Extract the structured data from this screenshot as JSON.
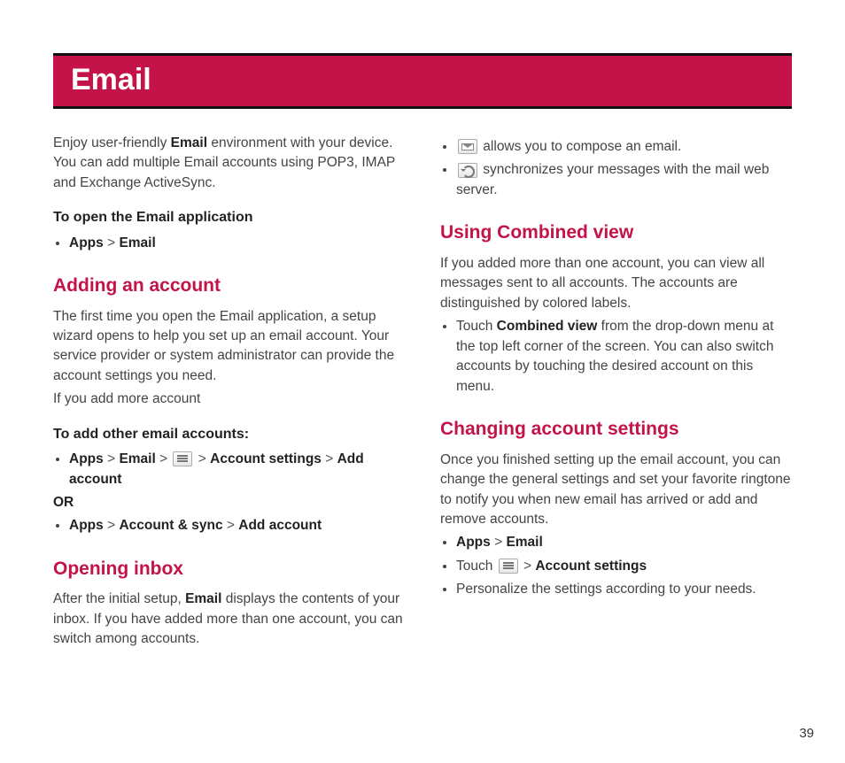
{
  "banner": {
    "title": "Email"
  },
  "left": {
    "intro": {
      "pre": "Enjoy user-friendly ",
      "bold": "Email",
      "post": " environment with your device. You can add multiple Email accounts using POP3, IMAP and Exchange ActiveSync."
    },
    "open_app": {
      "title": "To open the Email application",
      "path": {
        "a": "Apps",
        "sep": ">",
        "b": "Email"
      }
    },
    "adding": {
      "title": "Adding an account",
      "body1": "The first time you open the Email application, a setup wizard opens to help you set up an email account. Your service provider or system administrator can provide the account settings you need.",
      "body2": "If you add more account"
    },
    "add_other": {
      "title": "To add other email accounts:",
      "path1": {
        "a": "Apps",
        "b": "Email",
        "c": "Account settings",
        "d": "Add account"
      },
      "or": "OR",
      "path2": {
        "a": "Apps",
        "b": "Account & sync",
        "c": "Add account"
      },
      "sep": ">"
    },
    "opening_inbox": {
      "title": "Opening inbox",
      "pre": "After the initial setup, ",
      "bold": "Email",
      "post": " displays the contents of your inbox. If you have added more than one account, you can switch among accounts."
    }
  },
  "right": {
    "icon_list": {
      "compose": " allows you to compose an email.",
      "sync": " synchronizes your messages with the mail web server."
    },
    "combined": {
      "title": "Using Combined view",
      "body": "If you added more than one account, you can view all messages sent to all accounts. The accounts are distinguished by colored labels.",
      "bullet_pre": "Touch ",
      "bullet_bold": "Combined view",
      "bullet_post": " from the drop-down menu at the top left corner of the screen. You can also switch accounts by touching the desired account on this menu."
    },
    "changing": {
      "title": "Changing account settings",
      "body": "Once you finished setting up the email account, you can change the general settings and set your favorite ringtone to notify you when new email has arrived or add and remove accounts.",
      "b1": {
        "a": "Apps",
        "sep": ">",
        "b": "Email"
      },
      "b2": {
        "pre": "Touch ",
        "sep": ">",
        "bold": "Account settings"
      },
      "b3": "Personalize the settings according to your needs."
    }
  },
  "page_number": "39"
}
